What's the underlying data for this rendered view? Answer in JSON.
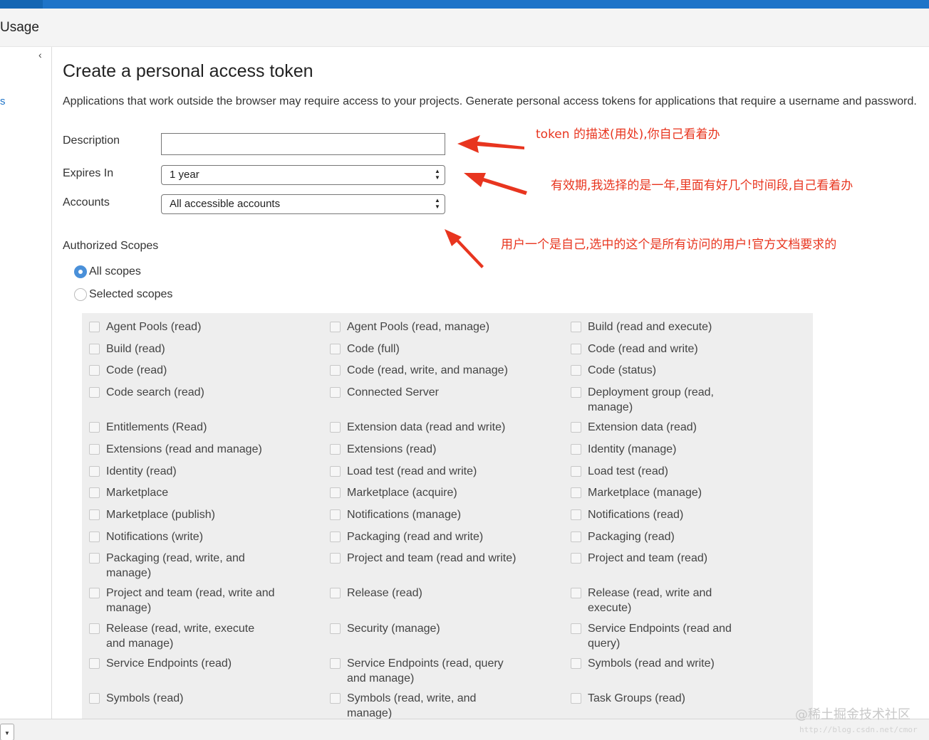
{
  "header": {
    "title": "Usage"
  },
  "sidebar": {
    "collapse_glyph": "‹",
    "fragment": "s"
  },
  "page": {
    "title": "Create a personal access token",
    "description": "Applications that work outside the browser may require access to your projects. Generate personal access tokens for applications that require a username and password."
  },
  "form": {
    "description_label": "Description",
    "description_value": "",
    "expires_label": "Expires In",
    "expires_value": "1 year",
    "accounts_label": "Accounts",
    "accounts_value": "All accessible accounts"
  },
  "scopes": {
    "title": "Authorized Scopes",
    "all_label": "All scopes",
    "selected_label": "Selected scopes",
    "selected_option": "all",
    "columns": [
      [
        "Agent Pools (read)",
        "Build (read)",
        "Code (read)",
        "Code search (read)",
        "Entitlements (Read)",
        "Extensions (read and manage)",
        "Identity (read)",
        "Marketplace",
        "Marketplace (publish)",
        "Notifications (write)",
        "Packaging (read, write, and manage)",
        "Project and team (read, write and manage)",
        "Release (read, write, execute and manage)",
        "Service Endpoints (read)",
        "Symbols (read)"
      ],
      [
        "Agent Pools (read, manage)",
        "Code (full)",
        "Code (read, write, and manage)",
        "Connected Server",
        "Extension data (read and write)",
        "Extensions (read)",
        "Load test (read and write)",
        "Marketplace (acquire)",
        "Notifications (manage)",
        "Packaging (read and write)",
        "Project and team (read and write)",
        "Release (read)",
        "Security (manage)",
        "Service Endpoints (read, query and manage)",
        "Symbols (read, write, and manage)"
      ],
      [
        "Build (read and execute)",
        "Code (read and write)",
        "Code (status)",
        "Deployment group (read, manage)",
        "Extension data (read)",
        "Identity (manage)",
        "Load test (read)",
        "Marketplace (manage)",
        "Notifications (read)",
        "Packaging (read)",
        "Project and team (read)",
        "Release (read, write and execute)",
        "Service Endpoints (read and query)",
        "Symbols (read and write)",
        "Task Groups (read)"
      ]
    ]
  },
  "annotations": {
    "description_note": "token 的描述(用处),你自己看着办",
    "expires_note": "有效期,我选择的是一年,里面有好几个时间段,自己看着办",
    "accounts_note": "用户一个是自己,选中的这个是所有访问的用户!官方文档要求的",
    "color": "#e8351f"
  },
  "watermark": {
    "text": "@稀土掘金技术社区",
    "url": "http://blog.csdn.net/cmor"
  },
  "colors": {
    "accent": "#1f74c8",
    "panel": "#eeeeee"
  }
}
